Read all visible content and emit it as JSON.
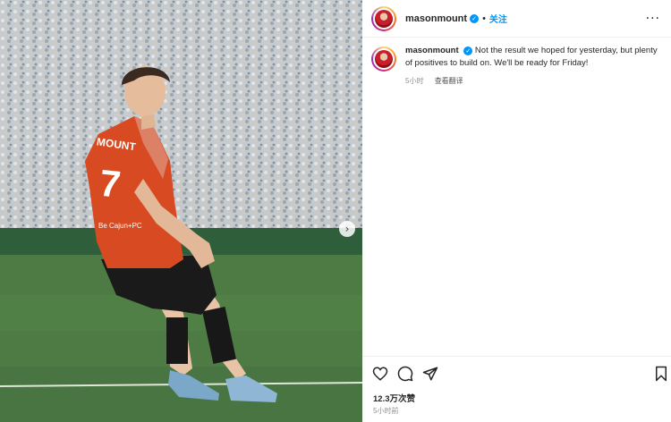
{
  "post": {
    "username": "masonmount",
    "verified_icon": "verified-badge-icon",
    "dot": "•",
    "follow_label": "关注",
    "more_label": "···"
  },
  "caption": {
    "username": "masonmount",
    "text": "Not the result we hoped for yesterday, but plenty of positives to build on. We'll be ready for Friday!",
    "time": "5小时",
    "translate_label": "查看翻译"
  },
  "actions": {
    "like_icon": "heart-icon",
    "comment_icon": "comment-icon",
    "share_icon": "send-icon",
    "save_icon": "bookmark-icon"
  },
  "stats": {
    "likes": "12.3万次赞",
    "posted": "5小时前"
  },
  "media": {
    "description_icon": "photo",
    "next_icon": "chevron-right-icon",
    "jersey_text": "MOUNT",
    "jersey_number": "7",
    "sponsor_text": "Be Cajun+PC",
    "colors": {
      "shirt": "#d84a21",
      "shorts": "#1a1a1a",
      "pitch": "#4d7b43"
    }
  }
}
